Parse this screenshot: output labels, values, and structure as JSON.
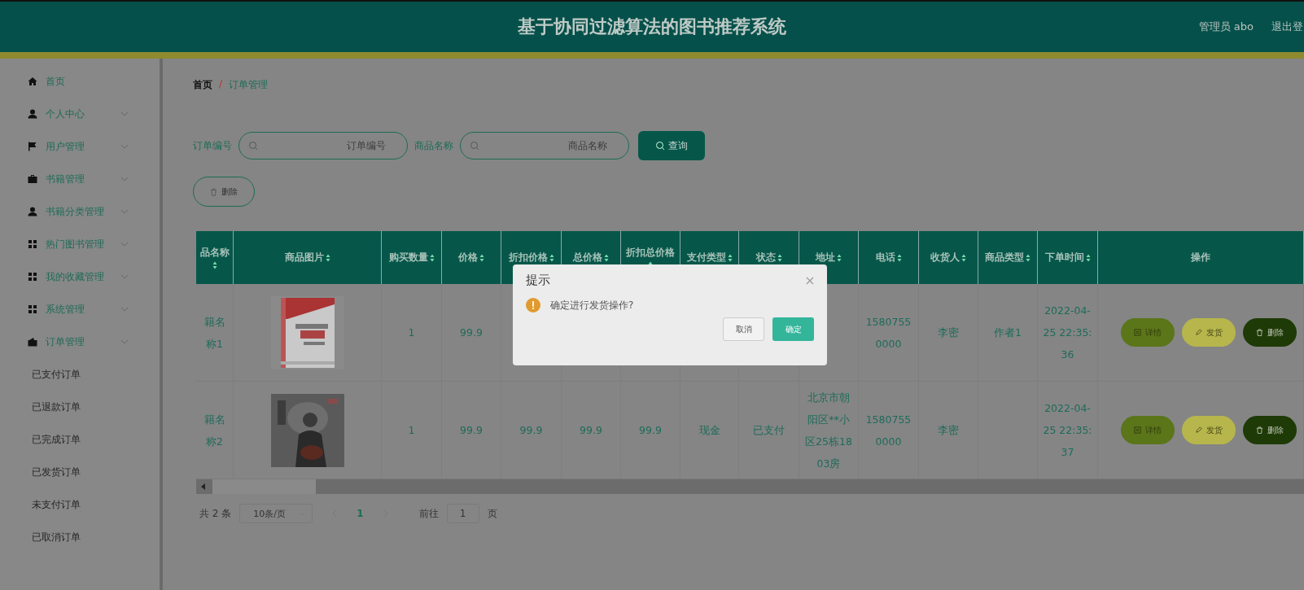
{
  "header": {
    "title": "基于协同过滤算法的图书推荐系统",
    "user": "管理员 abo",
    "logout": "退出登"
  },
  "sidebar": {
    "items": [
      {
        "label": "首页"
      },
      {
        "label": "个人中心"
      },
      {
        "label": "用户管理"
      },
      {
        "label": "书籍管理"
      },
      {
        "label": "书籍分类管理"
      },
      {
        "label": "热门图书管理"
      },
      {
        "label": "我的收藏管理"
      },
      {
        "label": "系统管理"
      },
      {
        "label": "订单管理",
        "children": [
          {
            "label": "已支付订单"
          },
          {
            "label": "已退款订单"
          },
          {
            "label": "已完成订单"
          },
          {
            "label": "已发货订单"
          },
          {
            "label": "未支付订单"
          },
          {
            "label": "已取消订单"
          }
        ]
      }
    ]
  },
  "breadcrumb": {
    "items": [
      "首页",
      "订单管理"
    ],
    "separator": "/"
  },
  "search": {
    "fields": [
      {
        "label": "订单编号",
        "placeholder": "订单编号"
      },
      {
        "label": "商品名称",
        "placeholder": "商品名称"
      }
    ],
    "button": "查询"
  },
  "delete_button": "删除",
  "table": {
    "columns": [
      {
        "label": "品名称",
        "sortable": true
      },
      {
        "label": "商品图片",
        "sortable": true
      },
      {
        "label": "购买数量",
        "sortable": true
      },
      {
        "label": "价格",
        "sortable": true
      },
      {
        "label": "折扣价格",
        "sortable": true
      },
      {
        "label": "总价格",
        "sortable": true
      },
      {
        "label": "折扣总价格",
        "sortable": true
      },
      {
        "label": "支付类型",
        "sortable": true
      },
      {
        "label": "状态",
        "sortable": true
      },
      {
        "label": "地址",
        "sortable": true
      },
      {
        "label": "电话",
        "sortable": true
      },
      {
        "label": "收货人",
        "sortable": true
      },
      {
        "label": "商品类型",
        "sortable": true
      },
      {
        "label": "下单时间",
        "sortable": true
      },
      {
        "label": "操作",
        "sortable": false
      }
    ],
    "rows": [
      {
        "cells": [
          "籍名称1",
          {
            "kind": "picture"
          },
          "1",
          "99.9",
          null,
          null,
          null,
          null,
          null,
          null,
          "15807550000",
          "李密",
          "作者1",
          "2022-04-25 22:35:36"
        ],
        "actions": [
          "详情",
          "发货",
          "删除"
        ]
      },
      {
        "cells": [
          "籍名称2",
          {
            "kind": "picture"
          },
          "1",
          "99.9",
          "99.9",
          "99.9",
          "99.9",
          "现金",
          "已支付",
          "北京市朝阳区**小区25栋1803房",
          "15807550000",
          "李密",
          null,
          "2022-04-25 22:35:37"
        ],
        "actions": [
          "详情",
          "发货",
          "删除"
        ]
      }
    ]
  },
  "pagination": {
    "total": "共 2 条",
    "page_size": "10条/页",
    "pages": [
      {
        "label": "1",
        "selected": true
      }
    ],
    "goto_label": "前往",
    "goto_value": "1",
    "goto_suffix": "页"
  },
  "dialog": {
    "title": "提示",
    "message": "确定进行发货操作?",
    "buttons": [
      {
        "label": "取消",
        "kind": "default"
      },
      {
        "label": "确定",
        "kind": "primary"
      }
    ]
  }
}
